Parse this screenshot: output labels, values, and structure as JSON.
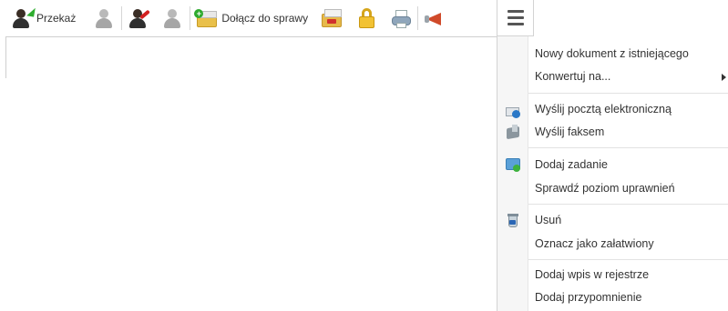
{
  "toolbar": {
    "forward_label": "Przekaż",
    "join_case_label": "Dołącz do sprawy",
    "icons": [
      "forward-icon",
      "forward-disabled-icon",
      "return-icon",
      "return-disabled-icon",
      "join-case-icon",
      "folder-remove-icon",
      "lock-icon",
      "print-icon",
      "announce-icon",
      "menu-icon"
    ]
  },
  "menu": {
    "items": [
      {
        "label": "Nowy dokument z istniejącego"
      },
      {
        "label": "Konwertuj na..."
      },
      {
        "label": "Wyślij pocztą elektroniczną"
      },
      {
        "label": "Wyślij faksem"
      },
      {
        "label": "Dodaj zadanie"
      },
      {
        "label": "Sprawdź poziom uprawnień"
      },
      {
        "label": "Usuń"
      },
      {
        "label": "Oznacz jako załatwiony"
      },
      {
        "label": "Dodaj wpis w rejestrze"
      },
      {
        "label": "Dodaj przypomnienie"
      }
    ]
  }
}
